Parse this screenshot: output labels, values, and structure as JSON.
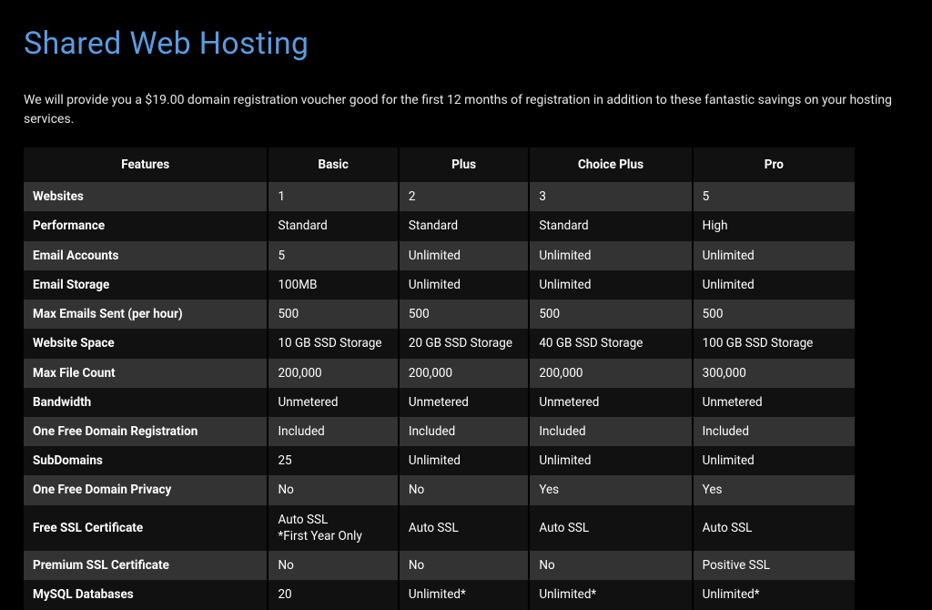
{
  "title": "Shared Web Hosting",
  "intro": "We will provide you a $19.00 domain registration voucher good for the first 12 months of registration in addition to these fantastic savings on your hosting services.",
  "table": {
    "headers": [
      "Features",
      "Basic",
      "Plus",
      "Choice Plus",
      "Pro"
    ],
    "rows": [
      {
        "label": "Websites",
        "values": [
          "1",
          "2",
          "3",
          "5"
        ]
      },
      {
        "label": "Performance",
        "values": [
          "Standard",
          "Standard",
          "Standard",
          "High"
        ]
      },
      {
        "label": "Email Accounts",
        "values": [
          "5",
          "Unlimited",
          "Unlimited",
          "Unlimited"
        ]
      },
      {
        "label": "Email Storage",
        "values": [
          "100MB",
          "Unlimited",
          "Unlimited",
          "Unlimited"
        ]
      },
      {
        "label": "Max Emails Sent (per hour)",
        "values": [
          "500",
          "500",
          "500",
          "500"
        ]
      },
      {
        "label": "Website Space",
        "values": [
          "10 GB SSD Storage",
          "20 GB SSD Storage",
          "40 GB SSD Storage",
          "100 GB SSD Storage"
        ]
      },
      {
        "label": "Max File Count",
        "values": [
          "200,000",
          "200,000",
          "200,000",
          "300,000"
        ]
      },
      {
        "label": "Bandwidth",
        "values": [
          "Unmetered",
          "Unmetered",
          "Unmetered",
          "Unmetered"
        ]
      },
      {
        "label": "One Free Domain Registration",
        "values": [
          "Included",
          "Included",
          "Included",
          "Included"
        ]
      },
      {
        "label": "SubDomains",
        "values": [
          "25",
          "Unlimited",
          "Unlimited",
          "Unlimited"
        ]
      },
      {
        "label": "One Free Domain Privacy",
        "values": [
          "No",
          "No",
          "Yes",
          "Yes"
        ]
      },
      {
        "label": "Free SSL Certificate",
        "values": [
          "Auto SSL\n*First Year Only",
          "Auto SSL",
          "Auto SSL",
          "Auto SSL"
        ]
      },
      {
        "label": "Premium SSL Certificate",
        "values": [
          "No",
          "No",
          "No",
          "Positive SSL"
        ]
      },
      {
        "label": "MySQL Databases",
        "values": [
          "20",
          "Unlimited*",
          "Unlimited*",
          "Unlimited*"
        ]
      }
    ]
  }
}
